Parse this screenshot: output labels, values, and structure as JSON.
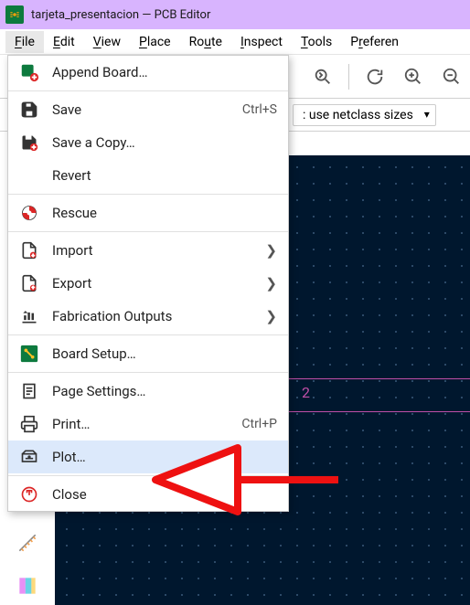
{
  "title": "tarjeta_presentacion — PCB Editor",
  "menubar": {
    "file": "File",
    "edit": "Edit",
    "view": "View",
    "place": "Place",
    "route": "Route",
    "inspect": "Inspect",
    "tools": "Tools",
    "preferences": "Preferen"
  },
  "rail": {
    "netclass": ": use netclass sizes"
  },
  "menu": {
    "append": "Append Board…",
    "save": "Save",
    "save_short": "Ctrl+S",
    "save_copy": "Save a Copy…",
    "revert": "Revert",
    "rescue": "Rescue",
    "import": "Import",
    "export": "Export",
    "fab": "Fabrication Outputs",
    "board_setup": "Board Setup…",
    "page_settings": "Page Settings…",
    "print": "Print…",
    "print_short": "Ctrl+P",
    "plot": "Plot…",
    "close": "Close"
  },
  "canvas": {
    "label2": "2"
  }
}
